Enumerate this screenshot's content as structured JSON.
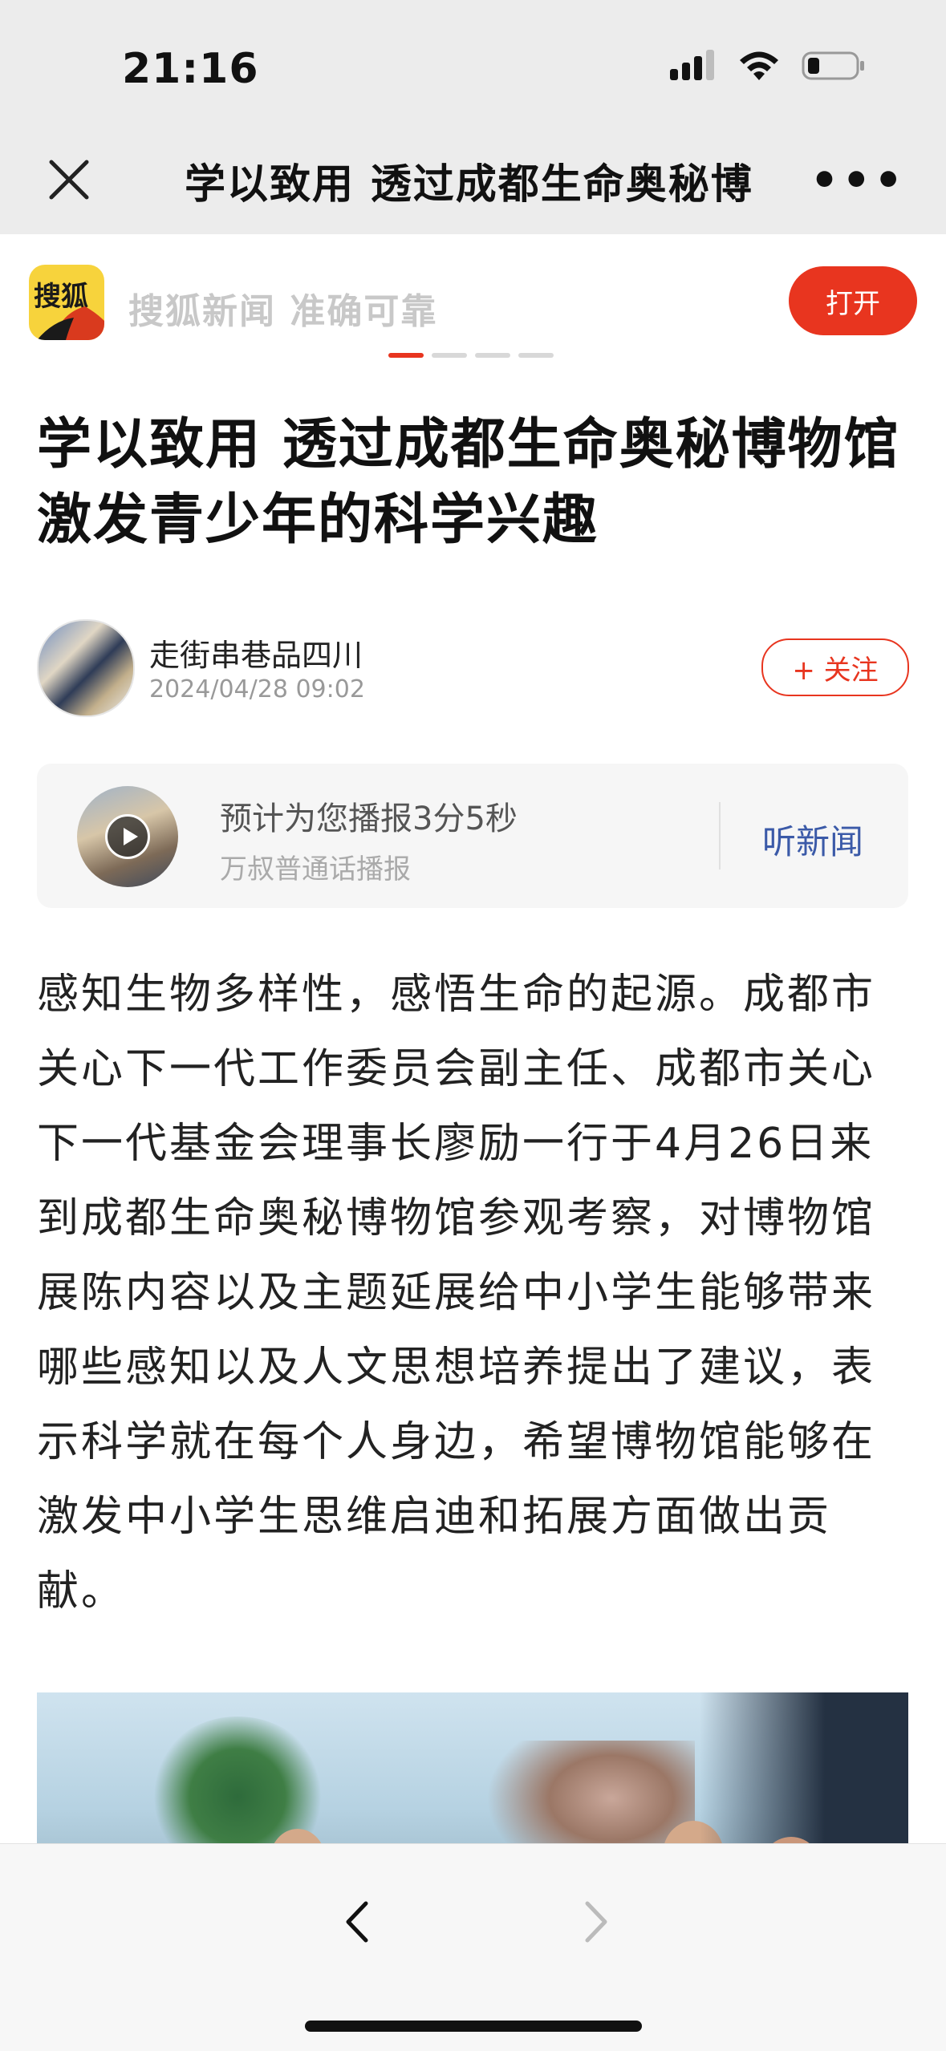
{
  "status_bar": {
    "time": "21:16"
  },
  "nav": {
    "title": "学以致用 透过成都生命奥秘博",
    "more": "•••"
  },
  "banner": {
    "logo_text": "搜狐",
    "slogan": "搜狐新闻 准确可靠",
    "open_label": "打开"
  },
  "article": {
    "headline": "学以致用 透过成都生命奥秘博物馆激发青少年的科学兴趣",
    "author": {
      "name": "走街串巷品四川",
      "time": "2024/04/28 09:02",
      "follow_label": "+ 关注"
    },
    "audio": {
      "title": "预计为您播报3分5秒",
      "subtitle": "万叔普通话播报",
      "listen_label": "听新闻"
    },
    "body": "感知生物多样性，感悟生命的起源。成都市关心下一代工作委员会副主任、成都市关心下一代基金会理事长廖励一行于4月26日来到成都生命奥秘博物馆参观考察，对博物馆展陈内容以及主题延展给中小学生能够带来哪些感知以及人文思想培养提出了建议，表示科学就在每个人身边，希望博物馆能够在激发中小学生思维启迪和拓展方面做出贡献。"
  },
  "colors": {
    "accent": "#e8351f",
    "link": "#3b5aa8"
  }
}
